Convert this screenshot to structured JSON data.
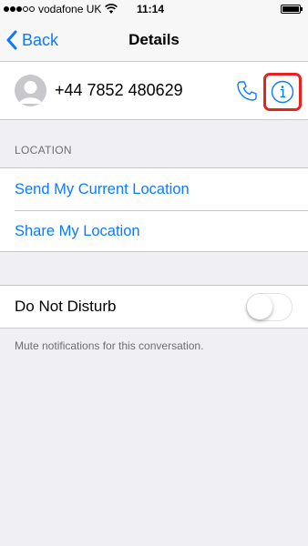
{
  "status_bar": {
    "signal_bars_filled": 3,
    "signal_bars_total": 5,
    "carrier": "vodafone UK",
    "time": "11:14",
    "icons": {
      "wifi": "wifi-icon",
      "battery": "battery-icon"
    }
  },
  "nav": {
    "back_label": "Back",
    "title": "Details"
  },
  "contact": {
    "phone_number": "+44 7852 480629",
    "icons": {
      "avatar": "avatar-placeholder-icon",
      "call": "phone-icon",
      "info": "info-icon"
    }
  },
  "location": {
    "header": "LOCATION",
    "items": [
      {
        "label": "Send My Current Location"
      },
      {
        "label": "Share My Location"
      }
    ]
  },
  "do_not_disturb": {
    "label": "Do Not Disturb",
    "enabled": false,
    "note": "Mute notifications for this conversation."
  },
  "colors": {
    "accent": "#0a7bff",
    "highlight": "#e8221f",
    "background": "#efeff4"
  }
}
